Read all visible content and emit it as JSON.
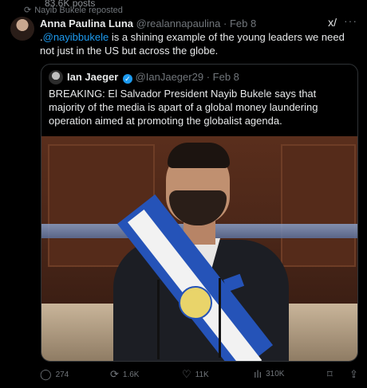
{
  "top": {
    "views_text": "83.6K posts",
    "repost_text": "Nayib Bukele reposted"
  },
  "tweet": {
    "author_name": "Anna Paulina Luna",
    "handle": "@realannapaulina",
    "dot": "·",
    "date": "Feb 8",
    "text_prefix": ".",
    "mention": "@nayibbukele",
    "text_rest": " is a shining example of the young leaders we need not just in the US but across the globe."
  },
  "quote": {
    "author_name": "Ian Jaeger",
    "verified_icon": "✓",
    "handle": "@IanJaeger29",
    "dot": "·",
    "date": "Feb 8",
    "text": "BREAKING: El Salvador President Nayib Bukele says that majority of the media is apart of a global money laundering operation aimed at promoting the globalist agenda."
  },
  "actions": {
    "replies": "274",
    "reposts": "1.6K",
    "likes": "11K",
    "views": "310K"
  },
  "icons": {
    "repost": "⟳",
    "grok": "x/",
    "more": "···",
    "reply": "◯",
    "like": "♡",
    "views": "ılı",
    "bookmark": "⌑",
    "share": "⇪"
  },
  "colors": {
    "background": "#000000",
    "text": "#e7e9ea",
    "muted": "#71767b",
    "link": "#1d9bf0",
    "border": "#2f3336"
  }
}
